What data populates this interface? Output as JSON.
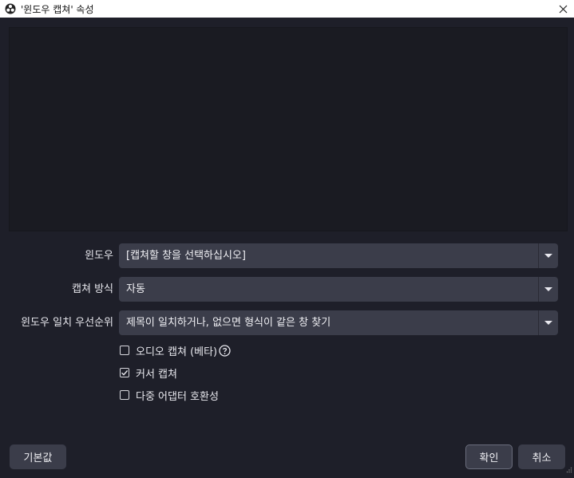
{
  "window": {
    "title": "'윈도우 캡쳐' 속성",
    "app_icon": "obs-logo-icon",
    "close_icon": "close-icon"
  },
  "form": {
    "window_label": "윈도우",
    "window_value": "[캡쳐할 창을 선택하십시오]",
    "method_label": "캡쳐 방식",
    "method_value": "자동",
    "priority_label": "윈도우 일치 우선순위",
    "priority_value": "제목이 일치하거나, 없으면 형식이 같은 창 찾기"
  },
  "checkboxes": [
    {
      "label": "오디오 캡쳐 (베타)",
      "checked": false,
      "help_icon": "help-circle-icon"
    },
    {
      "label": "커서 캡쳐",
      "checked": true
    },
    {
      "label": "다중 어댑터 호환성",
      "checked": false
    }
  ],
  "buttons": {
    "defaults": "기본값",
    "ok": "확인",
    "cancel": "취소"
  },
  "colors": {
    "background": "#1e1f29",
    "preview": "#1a1b22",
    "control": "#3b3d4a",
    "titlebar": "#ffffff"
  }
}
